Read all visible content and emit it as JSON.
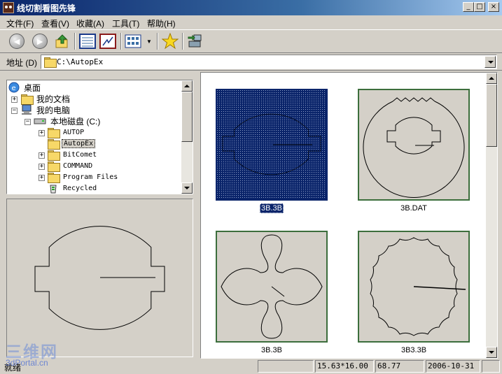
{
  "window": {
    "title": "线切割看图先锋",
    "controls": {
      "minimize": "_",
      "maximize": "□",
      "close": "×"
    }
  },
  "menu": {
    "items": [
      {
        "label": "文件(F)"
      },
      {
        "label": "查看(V)"
      },
      {
        "label": "收藏(A)"
      },
      {
        "label": "工具(T)"
      },
      {
        "label": "帮助(H)"
      }
    ]
  },
  "toolbar": {
    "icons": [
      "back-icon",
      "forward-icon",
      "up-folder-icon",
      "list-view-icon",
      "drawing-view-icon",
      "thumbnail-view-icon",
      "favorites-star-icon",
      "export-machine-icon"
    ]
  },
  "address": {
    "label": "地址 (D)",
    "value": "C:\\AutopEx"
  },
  "tree": {
    "items": [
      {
        "label": "桌面"
      },
      {
        "label": "我的文档"
      },
      {
        "label": "我的电脑"
      },
      {
        "label": "本地磁盘 (C:)"
      },
      {
        "label": "AUTOP"
      },
      {
        "label": "AutopEx"
      },
      {
        "label": "BitComet"
      },
      {
        "label": "COMMAND"
      },
      {
        "label": "Program Files"
      },
      {
        "label": "Recycled"
      }
    ],
    "selected": "AutopEx"
  },
  "files": [
    {
      "name": "3B.3B",
      "selected": true
    },
    {
      "name": "3B.DAT",
      "selected": false
    },
    {
      "name": "3B.3B",
      "selected": false
    },
    {
      "name": "3B3.3B",
      "selected": false
    }
  ],
  "status": {
    "text": "就绪",
    "cells": [
      "",
      "15.63*16.00",
      "68.77",
      "2006-10-31",
      ""
    ]
  },
  "watermark": {
    "main": "三维网",
    "sub": "3dPortal.cn"
  },
  "colors": {
    "selection": "#0a246a",
    "thumb_border": "#3c6e3c",
    "face": "#d4d0c8"
  }
}
